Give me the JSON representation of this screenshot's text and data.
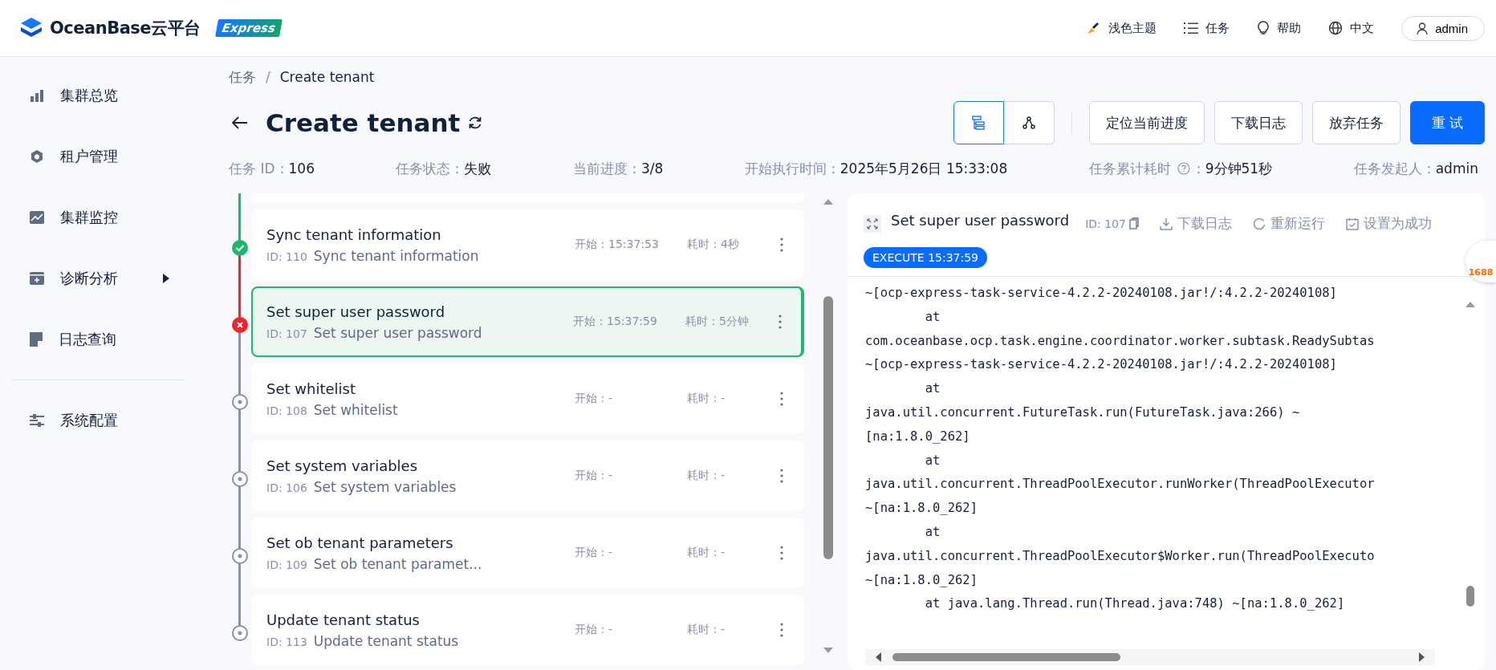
{
  "header": {
    "brand": "OceanBase云平台",
    "edition": "Express",
    "actions": [
      {
        "kind": "theme",
        "label": "浅色主题"
      },
      {
        "kind": "tasks",
        "label": "任务"
      },
      {
        "kind": "help",
        "label": "帮助"
      },
      {
        "kind": "language",
        "label": "中文"
      }
    ],
    "user": "admin"
  },
  "sidebar": {
    "items": [
      {
        "kind": "overview",
        "label": "集群总览",
        "has_submenu": false
      },
      {
        "kind": "tenant",
        "label": "租户管理",
        "has_submenu": false
      },
      {
        "kind": "monitor",
        "label": "集群监控",
        "has_submenu": false
      },
      {
        "kind": "diagnose",
        "label": "诊断分析",
        "has_submenu": true
      },
      {
        "kind": "log",
        "label": "日志查询",
        "has_submenu": false
      }
    ],
    "bottom_items": [
      {
        "kind": "config",
        "label": "系统配置",
        "has_submenu": false
      }
    ]
  },
  "breadcrumb": {
    "items": [
      "任务",
      "Create tenant"
    ],
    "separator": "/"
  },
  "title": "Create tenant",
  "view_toggle": [
    {
      "kind": "list",
      "selected": true
    },
    {
      "kind": "graph",
      "selected": false
    }
  ],
  "buttons": [
    {
      "label": "定位当前进度",
      "primary": false
    },
    {
      "label": "下载日志",
      "primary": false
    },
    {
      "label": "放弃任务",
      "primary": false
    },
    {
      "label": "重 试",
      "primary": true
    }
  ],
  "info": [
    {
      "label": "任务 ID：",
      "value": "106",
      "help": false
    },
    {
      "label": "任务状态：",
      "value": "失败",
      "help": false
    },
    {
      "label": "当前进度：",
      "value": "3/8",
      "help": false
    },
    {
      "label": "开始执行时间：",
      "value": "2025年5月26日 15:33:08",
      "help": false
    },
    {
      "label": "任务累计耗时",
      "colon": "：",
      "value": "9分钟51秒",
      "help": true
    },
    {
      "label": "任务发起人：",
      "value": "admin",
      "help": false
    }
  ],
  "steps": [
    {
      "name": "Sync tenant information",
      "id": "ID: 110",
      "description": "Sync tenant information",
      "start": "开始：15:37:53",
      "duration": "耗时：4秒",
      "kind": "success",
      "selected": false
    },
    {
      "name": "Set super user password",
      "id": "ID: 107",
      "description": "Set super user password",
      "start": "开始：15:37:59",
      "duration": "耗时：5分钟",
      "kind": "failed",
      "selected": true
    },
    {
      "name": "Set whitelist",
      "id": "ID: 108",
      "description": "Set whitelist",
      "start": "开始：-",
      "duration": "耗时：-",
      "kind": "pending",
      "selected": false
    },
    {
      "name": "Set system variables",
      "id": "ID: 106",
      "description": "Set system variables",
      "start": "开始：-",
      "duration": "耗时：-",
      "kind": "pending",
      "selected": false
    },
    {
      "name": "Set ob tenant parameters",
      "id": "ID: 109",
      "description": "Set ob tenant paramet...",
      "start": "开始：-",
      "duration": "耗时：-",
      "kind": "pending",
      "selected": false
    },
    {
      "name": "Update tenant status",
      "id": "ID: 113",
      "description": "Update tenant status",
      "start": "开始：-",
      "duration": "耗时：-",
      "kind": "pending",
      "selected": false
    }
  ],
  "detail": {
    "title": "Set super user password",
    "id": "ID: 107",
    "actions": [
      {
        "kind": "download",
        "label": "下载日志"
      },
      {
        "kind": "rerun",
        "label": "重新运行"
      },
      {
        "kind": "success",
        "label": "设置为成功"
      }
    ],
    "tag": "EXECUTE 15:37:59",
    "log": [
      "~[ocp-express-task-service-4.2.2-20240108.jar!/:4.2.2-20240108]",
      "        at",
      "com.oceanbase.ocp.task.engine.coordinator.worker.subtask.ReadySubtas",
      "~[ocp-express-task-service-4.2.2-20240108.jar!/:4.2.2-20240108]",
      "        at",
      "java.util.concurrent.FutureTask.run(FutureTask.java:266) ~",
      "[na:1.8.0_262]",
      "        at",
      "java.util.concurrent.ThreadPoolExecutor.runWorker(ThreadPoolExecutor",
      "~[na:1.8.0_262]",
      "        at",
      "java.util.concurrent.ThreadPoolExecutor$Worker.run(ThreadPoolExecuto",
      "~[na:1.8.0_262]",
      "        at java.lang.Thread.run(Thread.java:748) ~[na:1.8.0_262]"
    ]
  },
  "floating_widget": "1688"
}
